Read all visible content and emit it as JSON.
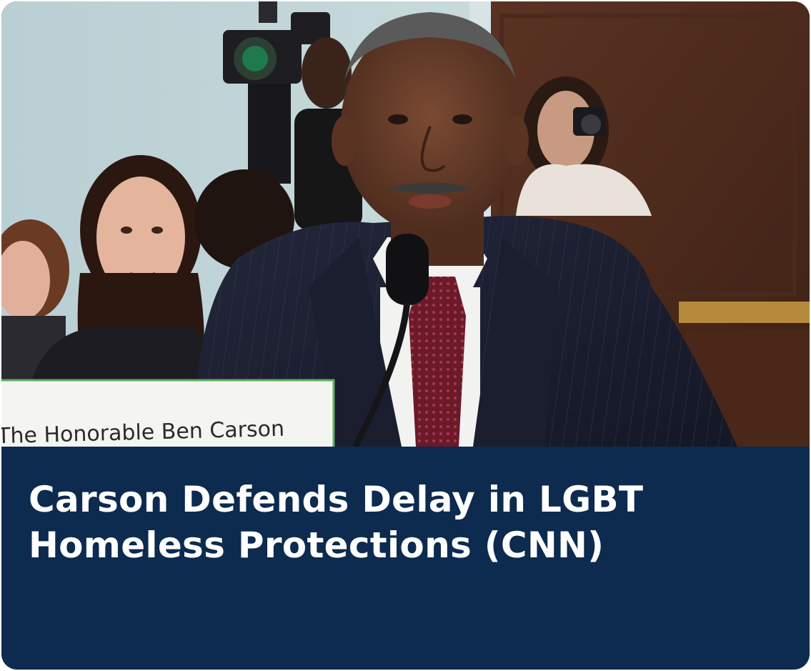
{
  "card": {
    "headline": "Carson Defends Delay in LGBT Homeless Protections (CNN)",
    "nameplate_text": "The Honorable Ben Carson",
    "caption_bg_color": "#0d2a4f",
    "caption_text_color": "#ffffff"
  }
}
